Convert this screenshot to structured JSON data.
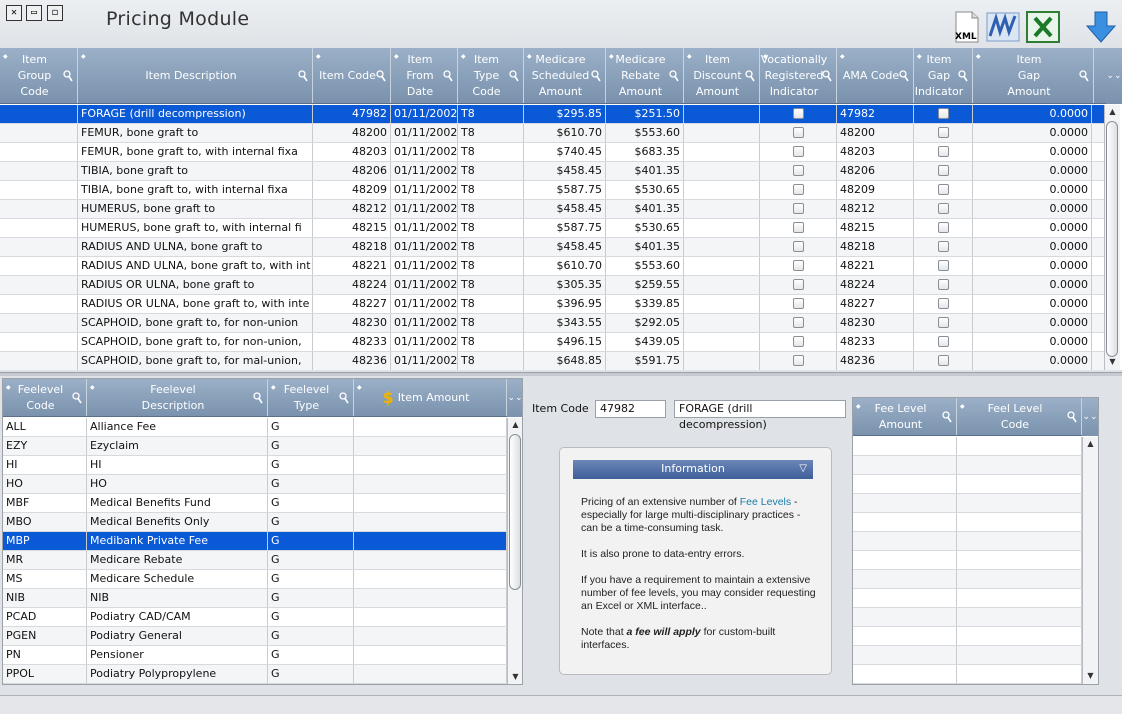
{
  "window": {
    "title": "Pricing Module",
    "controls": [
      "close-icon",
      "minimize-icon",
      "maximize-icon"
    ],
    "toolbar": [
      {
        "name": "xml-export-icon",
        "label": "XML"
      },
      {
        "name": "word-export-icon"
      },
      {
        "name": "excel-export-icon"
      },
      {
        "name": "download-arrow-icon"
      }
    ]
  },
  "items_grid": {
    "columns": [
      "Item\nGroup\nCode",
      "Item Description",
      "Item Code",
      "Item From\nDate",
      "Item Type\nCode",
      "Medicare\nScheduled\nAmount",
      "Medicare\nRebate\nAmount",
      "Item\nDiscount\nAmount",
      "Vocationally\nRegistered\nIndicator",
      "AMA Code",
      "Item\nGap\nIndicator",
      "Item\nGap\nAmount"
    ],
    "rows": [
      {
        "group": "",
        "desc": "FORAGE (drill decompression)",
        "code": "47982",
        "date": "01/11/2002",
        "type": "T8",
        "sched": "$295.85",
        "rebate": "$251.50",
        "discount": "",
        "ama": "47982",
        "gap": "0.0000",
        "selected": true
      },
      {
        "group": "",
        "desc": "FEMUR, bone graft to",
        "code": "48200",
        "date": "01/11/2002",
        "type": "T8",
        "sched": "$610.70",
        "rebate": "$553.60",
        "discount": "",
        "ama": "48200",
        "gap": "0.0000"
      },
      {
        "group": "",
        "desc": "FEMUR, bone graft to, with internal fixa",
        "code": "48203",
        "date": "01/11/2002",
        "type": "T8",
        "sched": "$740.45",
        "rebate": "$683.35",
        "discount": "",
        "ama": "48203",
        "gap": "0.0000"
      },
      {
        "group": "",
        "desc": "TIBIA, bone graft to",
        "code": "48206",
        "date": "01/11/2002",
        "type": "T8",
        "sched": "$458.45",
        "rebate": "$401.35",
        "discount": "",
        "ama": "48206",
        "gap": "0.0000"
      },
      {
        "group": "",
        "desc": "TIBIA, bone graft to, with internal fixa",
        "code": "48209",
        "date": "01/11/2002",
        "type": "T8",
        "sched": "$587.75",
        "rebate": "$530.65",
        "discount": "",
        "ama": "48209",
        "gap": "0.0000"
      },
      {
        "group": "",
        "desc": "HUMERUS, bone graft to",
        "code": "48212",
        "date": "01/11/2002",
        "type": "T8",
        "sched": "$458.45",
        "rebate": "$401.35",
        "discount": "",
        "ama": "48212",
        "gap": "0.0000"
      },
      {
        "group": "",
        "desc": "HUMERUS, bone graft to, with internal fi",
        "code": "48215",
        "date": "01/11/2002",
        "type": "T8",
        "sched": "$587.75",
        "rebate": "$530.65",
        "discount": "",
        "ama": "48215",
        "gap": "0.0000"
      },
      {
        "group": "",
        "desc": "RADIUS AND ULNA, bone graft to",
        "code": "48218",
        "date": "01/11/2002",
        "type": "T8",
        "sched": "$458.45",
        "rebate": "$401.35",
        "discount": "",
        "ama": "48218",
        "gap": "0.0000"
      },
      {
        "group": "",
        "desc": "RADIUS AND ULNA, bone graft to, with int",
        "code": "48221",
        "date": "01/11/2002",
        "type": "T8",
        "sched": "$610.70",
        "rebate": "$553.60",
        "discount": "",
        "ama": "48221",
        "gap": "0.0000"
      },
      {
        "group": "",
        "desc": "RADIUS OR ULNA, bone graft to",
        "code": "48224",
        "date": "01/11/2002",
        "type": "T8",
        "sched": "$305.35",
        "rebate": "$259.55",
        "discount": "",
        "ama": "48224",
        "gap": "0.0000"
      },
      {
        "group": "",
        "desc": "RADIUS OR ULNA, bone graft to, with inte",
        "code": "48227",
        "date": "01/11/2002",
        "type": "T8",
        "sched": "$396.95",
        "rebate": "$339.85",
        "discount": "",
        "ama": "48227",
        "gap": "0.0000"
      },
      {
        "group": "",
        "desc": "SCAPHOID, bone graft to, for non-union",
        "code": "48230",
        "date": "01/11/2002",
        "type": "T8",
        "sched": "$343.55",
        "rebate": "$292.05",
        "discount": "",
        "ama": "48230",
        "gap": "0.0000"
      },
      {
        "group": "",
        "desc": "SCAPHOID, bone graft to, for non-union,",
        "code": "48233",
        "date": "01/11/2002",
        "type": "T8",
        "sched": "$496.15",
        "rebate": "$439.05",
        "discount": "",
        "ama": "48233",
        "gap": "0.0000"
      },
      {
        "group": "",
        "desc": "SCAPHOID, bone graft to, for mal-union,",
        "code": "48236",
        "date": "01/11/2002",
        "type": "T8",
        "sched": "$648.85",
        "rebate": "$591.75",
        "discount": "",
        "ama": "48236",
        "gap": "0.0000"
      }
    ]
  },
  "feelevel_grid": {
    "columns": [
      "Feelevel\nCode",
      "Feelevel\nDescription",
      "Feelevel\nType",
      "Item Amount"
    ],
    "rows": [
      {
        "code": "ALL",
        "desc": "Alliance Fee",
        "type": "G"
      },
      {
        "code": "EZY",
        "desc": "Ezyclaim",
        "type": "G"
      },
      {
        "code": "HI",
        "desc": "HI",
        "type": "G"
      },
      {
        "code": "HO",
        "desc": "HO",
        "type": "G"
      },
      {
        "code": "MBF",
        "desc": "Medical Benefits Fund",
        "type": "G"
      },
      {
        "code": "MBO",
        "desc": "Medical Benefits Only",
        "type": "G"
      },
      {
        "code": "MBP",
        "desc": "Medibank Private Fee",
        "type": "G",
        "selected": true
      },
      {
        "code": "MR",
        "desc": "Medicare Rebate",
        "type": "G"
      },
      {
        "code": "MS",
        "desc": "Medicare Schedule",
        "type": "G"
      },
      {
        "code": "NIB",
        "desc": "NIB",
        "type": "G"
      },
      {
        "code": "PCAD",
        "desc": "Podiatry CAD/CAM",
        "type": "G"
      },
      {
        "code": "PGEN",
        "desc": "Podiatry General",
        "type": "G"
      },
      {
        "code": "PN",
        "desc": "Pensioner",
        "type": "G"
      },
      {
        "code": "PPOL",
        "desc": "Podiatry Polypropylene",
        "type": "G"
      }
    ]
  },
  "item_code": {
    "label": "Item Code",
    "code": "47982",
    "description": "FORAGE (drill decompression)"
  },
  "info": {
    "title": "Information",
    "p1_pre": "Pricing of an extensive number of ",
    "p1_link": "Fee Levels",
    "p1_post": " - especially for large multi-disciplinary practices - can be a time-consuming task.",
    "p2": "It is also prone to data-entry errors.",
    "p3": "If you have a requirement to maintain a extensive number of fee levels, you may consider requesting an Excel or XML interface..",
    "p4_pre": "Note that ",
    "p4_em": "a fee will apply",
    "p4_post": " for custom-built interfaces."
  },
  "fee_amount_grid": {
    "columns": [
      "Fee Level\nAmount",
      "Feel Level\nCode"
    ],
    "rows": 14
  },
  "colors": {
    "selection": "#0a59d6",
    "header": "#8aa0ba",
    "accent_link": "#1a7ca8"
  }
}
